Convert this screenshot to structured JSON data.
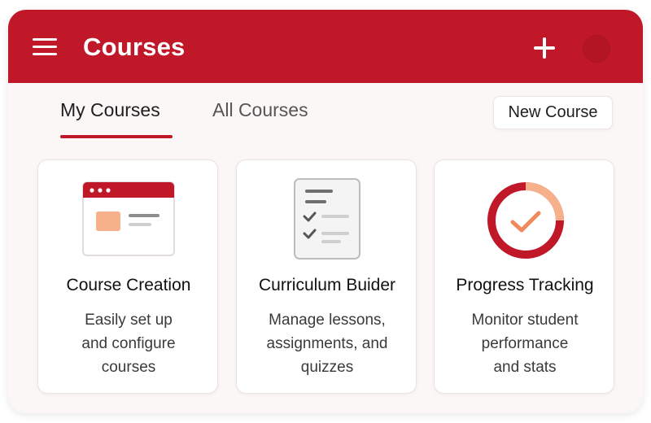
{
  "header": {
    "title": "Courses",
    "menu_icon": "hamburger-menu-icon",
    "add_icon": "plus-icon",
    "avatar_icon": "user-avatar",
    "brand_color": "#c01828"
  },
  "tabs": [
    {
      "label": "My Courses",
      "active": true
    },
    {
      "label": "All Courses",
      "active": false
    }
  ],
  "new_course_label": "New Course",
  "cards": [
    {
      "title": "Course Creation",
      "desc_lines": [
        "Easily set up",
        "and configure",
        "courses"
      ],
      "icon": "course-window-icon"
    },
    {
      "title": "Curriculum Buider",
      "desc_lines": [
        "Manage lessons,",
        "assignments, and",
        "quizzes"
      ],
      "icon": "checklist-icon"
    },
    {
      "title": "Progress Tracking",
      "desc_lines": [
        "Monitor student",
        "performance",
        "and stats"
      ],
      "icon": "progress-ring-icon",
      "progress_fraction": 0.25
    }
  ],
  "colors": {
    "accent": "#c01828",
    "accent_light": "#f6b08a",
    "muted": "#d9d9d9"
  }
}
